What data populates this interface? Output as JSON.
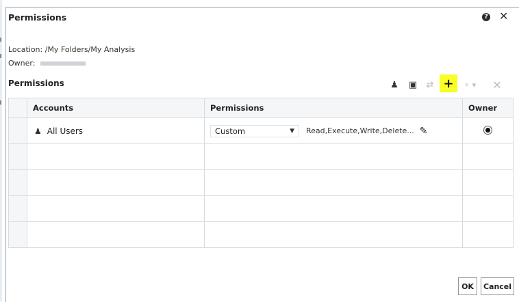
{
  "dialog": {
    "title": "Permissions",
    "help_icon": "question-circle",
    "close_icon": "x"
  },
  "info": {
    "location_label": "Location:",
    "location_value": "/My Folders/My Analysis",
    "owner_label": "Owner:"
  },
  "section_title": "Permissions",
  "toolbar": {
    "icons": [
      "add-user-icon",
      "add-folder-icon",
      "transfer-icon",
      "add-icon",
      "role-icon",
      "delete-icon"
    ]
  },
  "table": {
    "headers": {
      "accounts": "Accounts",
      "permissions": "Permissions",
      "owner": "Owner"
    },
    "rows": [
      {
        "account": "All Users",
        "permission": "Custom",
        "summary": "Read,Execute,Write,Delete...",
        "owner_selected": true
      }
    ],
    "empty_rows": 4
  },
  "buttons": {
    "ok": "OK",
    "cancel": "Cancel"
  },
  "colors": {
    "highlight": "#f7ff24",
    "border": "#d6dbe0",
    "header_bg": "#f4f6f8"
  }
}
